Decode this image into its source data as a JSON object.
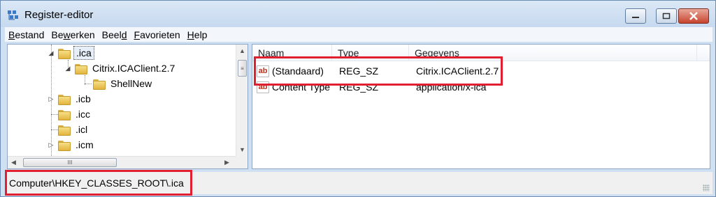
{
  "window": {
    "title": "Register-editor",
    "controls": {
      "minimize_icon": "minimize-icon",
      "maximize_icon": "maximize-icon",
      "close_icon": "close-icon"
    }
  },
  "menu": {
    "items": [
      {
        "label": "Bestand",
        "accel": "B"
      },
      {
        "label": "Bewerken",
        "accel": "w"
      },
      {
        "label": "Beeld",
        "accel": "d"
      },
      {
        "label": "Favorieten",
        "accel": "F"
      },
      {
        "label": "Help",
        "accel": "H"
      }
    ]
  },
  "tree": {
    "nodes": [
      {
        "label": ".ica",
        "expander": "◢",
        "selected": true
      },
      {
        "label": "Citrix.ICAClient.2.7",
        "expander": "◢"
      },
      {
        "label": "ShellNew",
        "expander": ""
      },
      {
        "label": ".icb",
        "expander": "▷"
      },
      {
        "label": ".icc",
        "expander": ""
      },
      {
        "label": ".icl",
        "expander": ""
      },
      {
        "label": ".icm",
        "expander": "▷"
      }
    ]
  },
  "values": {
    "columns": {
      "name": "Naam",
      "type": "Type",
      "data": "Gegevens"
    },
    "rows": [
      {
        "name": "(Standaard)",
        "type": "REG_SZ",
        "data": "Citrix.ICAClient.2.7",
        "icon": "ab"
      },
      {
        "name": "Content Type",
        "type": "REG_SZ",
        "data": "application/x-ica",
        "icon": "ab"
      }
    ]
  },
  "status": {
    "path": "Computer\\HKEY_CLASSES_ROOT\\.ica"
  },
  "colors": {
    "highlight": "#e02030",
    "titlebar": "#c6d9ef",
    "value_icon": "#c0311c"
  }
}
